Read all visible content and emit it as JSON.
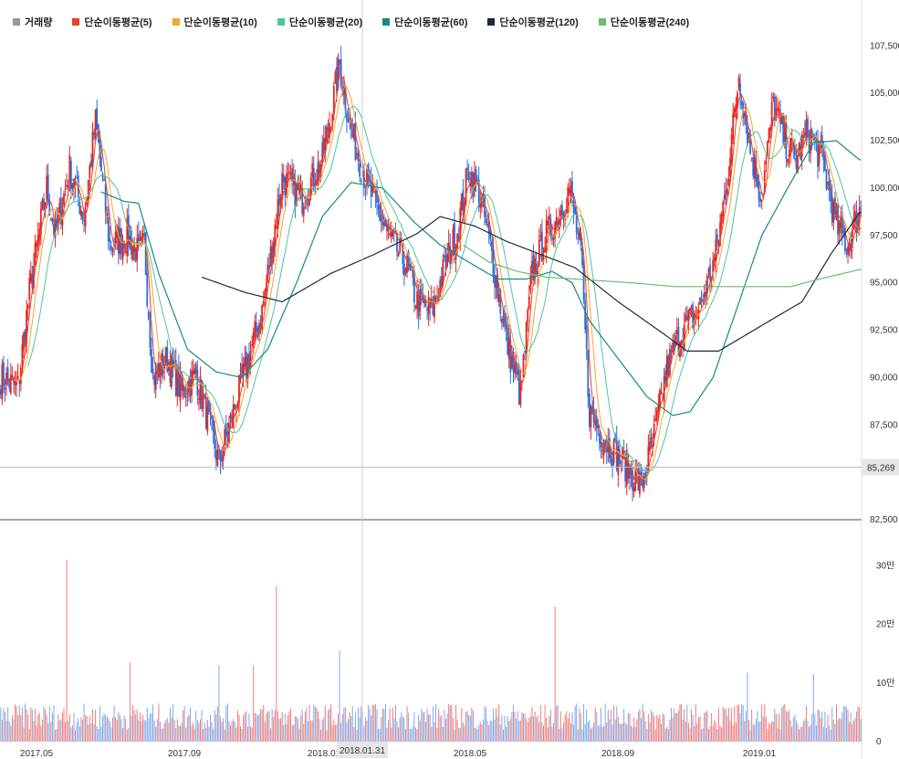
{
  "legend": [
    {
      "label": "거래량",
      "color": "#999999"
    },
    {
      "label": "단순이동평균(5)",
      "color": "#e8402f"
    },
    {
      "label": "단순이동평균(10)",
      "color": "#f0a830"
    },
    {
      "label": "단순이동평균(20)",
      "color": "#4fc3a1"
    },
    {
      "label": "단순이동평균(60)",
      "color": "#168a80"
    },
    {
      "label": "단순이동평균(120)",
      "color": "#1e2a3a"
    },
    {
      "label": "단순이동평균(240)",
      "color": "#6dbb6d"
    }
  ],
  "chart_data": {
    "type": "candlestick",
    "price_axis": {
      "ticks": [
        "107,500",
        "105,000",
        "102,500",
        "100,000",
        "97,500",
        "95,000",
        "92,500",
        "90,000",
        "87,500",
        "82,500"
      ],
      "values": [
        107500,
        105000,
        102500,
        100000,
        97500,
        95000,
        92500,
        90000,
        87500,
        82500
      ],
      "ylim": [
        82500,
        108000
      ]
    },
    "volume_axis": {
      "ticks": [
        "30만",
        "20만",
        "10만",
        "0"
      ],
      "values": [
        300000,
        200000,
        100000,
        0
      ],
      "ylim": [
        0,
        330000
      ]
    },
    "x_ticks": [
      "2017.05",
      "2017.09",
      "2018.01",
      "2018.05",
      "2018.09",
      "2019.01"
    ],
    "crosshair": {
      "price_label": "85,269",
      "price": 85269,
      "date_label": "2018.01.31"
    },
    "up_color": "#e8241c",
    "down_color": "#2a6fdb",
    "price_anchors": [
      [
        0,
        90000
      ],
      [
        12,
        89500
      ],
      [
        20,
        94500
      ],
      [
        32,
        100000
      ],
      [
        38,
        97500
      ],
      [
        48,
        101000
      ],
      [
        58,
        98500
      ],
      [
        66,
        103500
      ],
      [
        76,
        97000
      ],
      [
        88,
        97500
      ],
      [
        96,
        96500
      ],
      [
        100,
        97000
      ],
      [
        106,
        90000
      ],
      [
        116,
        91000
      ],
      [
        126,
        89200
      ],
      [
        136,
        90200
      ],
      [
        152,
        85500
      ],
      [
        168,
        89800
      ],
      [
        182,
        93500
      ],
      [
        196,
        100500
      ],
      [
        210,
        99500
      ],
      [
        224,
        101500
      ],
      [
        236,
        106500
      ],
      [
        244,
        103000
      ],
      [
        256,
        100000
      ],
      [
        270,
        97500
      ],
      [
        282,
        96000
      ],
      [
        290,
        94000
      ],
      [
        300,
        93500
      ],
      [
        310,
        96000
      ],
      [
        318,
        97800
      ],
      [
        326,
        101000
      ],
      [
        334,
        99500
      ],
      [
        342,
        96500
      ],
      [
        352,
        92000
      ],
      [
        362,
        89000
      ],
      [
        370,
        95500
      ],
      [
        380,
        97500
      ],
      [
        388,
        98500
      ],
      [
        396,
        100000
      ],
      [
        404,
        96500
      ],
      [
        410,
        88200
      ],
      [
        420,
        86800
      ],
      [
        434,
        85500
      ],
      [
        446,
        84300
      ],
      [
        454,
        86500
      ],
      [
        464,
        90500
      ],
      [
        474,
        92500
      ],
      [
        486,
        93500
      ],
      [
        498,
        96500
      ],
      [
        506,
        100500
      ],
      [
        514,
        106000
      ],
      [
        522,
        102000
      ],
      [
        530,
        99500
      ],
      [
        538,
        104500
      ],
      [
        546,
        102500
      ],
      [
        554,
        101500
      ],
      [
        562,
        103000
      ],
      [
        572,
        101500
      ],
      [
        582,
        98000
      ],
      [
        590,
        97000
      ],
      [
        598,
        98800
      ]
    ],
    "ma_anchors": {
      "ma120": [
        [
          140,
          95300
        ],
        [
          170,
          94500
        ],
        [
          196,
          94000
        ],
        [
          230,
          95500
        ],
        [
          260,
          96500
        ],
        [
          290,
          97600
        ],
        [
          306,
          98500
        ],
        [
          330,
          98000
        ],
        [
          352,
          97200
        ],
        [
          376,
          96500
        ],
        [
          400,
          95800
        ],
        [
          430,
          94000
        ],
        [
          460,
          92400
        ],
        [
          478,
          91400
        ],
        [
          500,
          91400
        ],
        [
          520,
          92300
        ],
        [
          540,
          93200
        ],
        [
          558,
          94000
        ],
        [
          578,
          96500
        ],
        [
          598,
          98700
        ]
      ],
      "ma240": [
        [
          322,
          97000
        ],
        [
          340,
          96100
        ],
        [
          360,
          95600
        ],
        [
          380,
          95300
        ],
        [
          400,
          95200
        ],
        [
          440,
          95000
        ],
        [
          470,
          94800
        ],
        [
          520,
          94800
        ],
        [
          550,
          94800
        ],
        [
          570,
          95200
        ],
        [
          598,
          95700
        ]
      ],
      "ma60": [
        [
          70,
          99800
        ],
        [
          86,
          99300
        ],
        [
          96,
          99200
        ],
        [
          110,
          95500
        ],
        [
          130,
          91500
        ],
        [
          150,
          90300
        ],
        [
          168,
          90000
        ],
        [
          186,
          91500
        ],
        [
          206,
          95000
        ],
        [
          224,
          98500
        ],
        [
          244,
          100300
        ],
        [
          266,
          100000
        ],
        [
          288,
          98200
        ],
        [
          306,
          97000
        ],
        [
          328,
          96000
        ],
        [
          346,
          95200
        ],
        [
          366,
          95200
        ],
        [
          384,
          95600
        ],
        [
          398,
          95000
        ],
        [
          410,
          93000
        ],
        [
          430,
          91000
        ],
        [
          450,
          89000
        ],
        [
          468,
          88000
        ],
        [
          480,
          88200
        ],
        [
          496,
          90000
        ],
        [
          512,
          93500
        ],
        [
          530,
          97500
        ],
        [
          548,
          100000
        ],
        [
          566,
          102400
        ],
        [
          582,
          102500
        ],
        [
          598,
          101500
        ]
      ]
    },
    "volume_spikes": [
      [
        46,
        310000
      ],
      [
        192,
        265000
      ],
      [
        236,
        155000
      ],
      [
        386,
        230000
      ],
      [
        90,
        135000
      ],
      [
        152,
        130000
      ],
      [
        176,
        130000
      ],
      [
        520,
        118000
      ],
      [
        566,
        115000
      ]
    ]
  }
}
